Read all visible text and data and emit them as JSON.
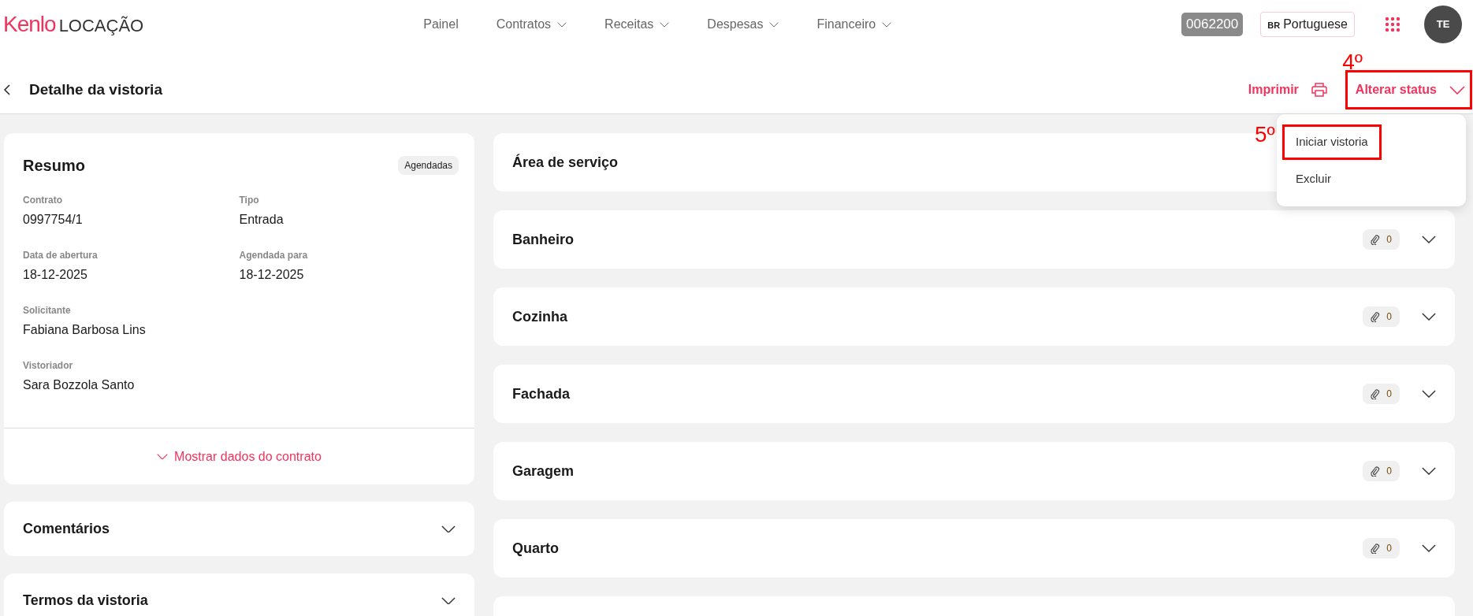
{
  "brand": {
    "logo": "Kenlo",
    "product": "LOCAÇÃO"
  },
  "nav": [
    {
      "label": "Painel",
      "dropdown": false
    },
    {
      "label": "Contratos",
      "dropdown": true
    },
    {
      "label": "Receitas",
      "dropdown": true
    },
    {
      "label": "Despesas",
      "dropdown": true
    },
    {
      "label": "Financeiro",
      "dropdown": true
    }
  ],
  "account_code": "0062200",
  "language": {
    "flag": "BR",
    "label": "Portuguese"
  },
  "avatar": "TE",
  "page_title": "Detalhe da vistoria",
  "actions": {
    "print": "Imprimir",
    "status": "Alterar status"
  },
  "status_menu": [
    {
      "label": "Iniciar vistoria",
      "highlighted": true
    },
    {
      "label": "Excluir",
      "highlighted": false
    }
  ],
  "annotations": [
    "4º",
    "5º"
  ],
  "summary": {
    "title": "Resumo",
    "badge": "Agendadas",
    "fields": [
      {
        "label": "Contrato",
        "value": "0997754/1"
      },
      {
        "label": "Tipo",
        "value": "Entrada"
      },
      {
        "label": "Data de abertura",
        "value": "18-12-2025"
      },
      {
        "label": "Agendada para",
        "value": "18-12-2025"
      },
      {
        "label": "Solicitante",
        "value": "Fabiana Barbosa Lins"
      },
      {
        "label": "Vistoriador",
        "value": "Sara Bozzola Santo"
      }
    ],
    "toggle": "Mostrar dados do contrato"
  },
  "panels": [
    {
      "title": "Comentários"
    },
    {
      "title": "Termos da vistoria"
    }
  ],
  "rooms": [
    {
      "title": "Área de serviço"
    },
    {
      "title": "Banheiro",
      "attachments": "0"
    },
    {
      "title": "Cozinha",
      "attachments": "0"
    },
    {
      "title": "Fachada",
      "attachments": "0"
    },
    {
      "title": "Garagem",
      "attachments": "0"
    },
    {
      "title": "Quarto",
      "attachments": "0"
    }
  ]
}
